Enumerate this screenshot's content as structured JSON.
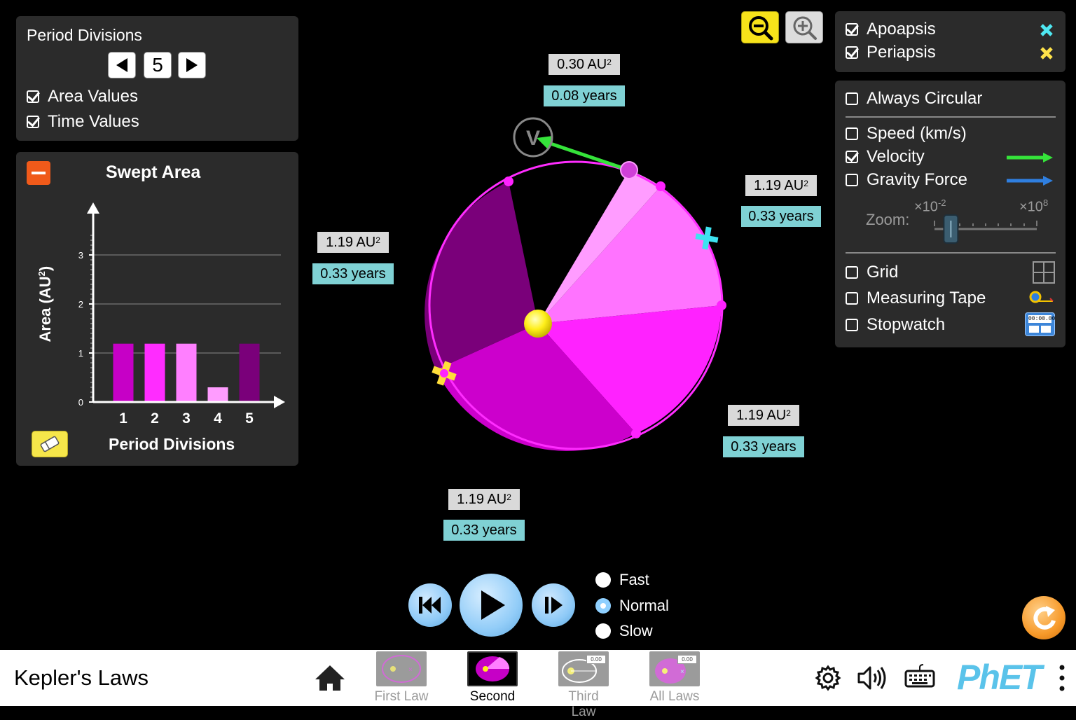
{
  "app": {
    "title": "Kepler's Laws"
  },
  "period_panel": {
    "title": "Period Divisions",
    "value": "5",
    "checkboxes": [
      {
        "label": "Area Values",
        "checked": true
      },
      {
        "label": "Time Values",
        "checked": true
      }
    ]
  },
  "swept_panel": {
    "title": "Swept Area",
    "ylabel": "Area (AU",
    "ylabel_exp": "2",
    "ylabel_close": ")",
    "xlabel": "Period Divisions"
  },
  "chart_data": {
    "type": "bar",
    "title": "Swept Area",
    "xlabel": "Period Divisions",
    "ylabel": "Area (AU²)",
    "categories": [
      "1",
      "2",
      "3",
      "4",
      "5"
    ],
    "values": [
      1.19,
      1.19,
      1.19,
      0.3,
      1.19
    ],
    "colors": [
      "#c600c6",
      "#ff2cff",
      "#ff7fff",
      "#ff9cff",
      "#7a007a"
    ],
    "y_ticks": [
      "0",
      "1",
      "2",
      "3"
    ],
    "ylim": [
      0,
      3.5
    ],
    "grid": true
  },
  "orbit_labels": [
    {
      "area": "0.30 AU",
      "time": "0.08 years"
    },
    {
      "area": "1.19 AU",
      "time": "0.33 years"
    },
    {
      "area": "1.19 AU",
      "time": "0.33 years"
    },
    {
      "area": "1.19 AU",
      "time": "0.33 years"
    },
    {
      "area": "1.19 AU",
      "time": "0.33 years"
    }
  ],
  "area_exp": "2",
  "velocity_label": "V",
  "markers_panel": {
    "items": [
      {
        "label": "Apoapsis",
        "checked": true,
        "color": "#4fe8f2"
      },
      {
        "label": "Periapsis",
        "checked": true,
        "color": "#ffe34a"
      }
    ]
  },
  "options_panel": {
    "always_circular": {
      "label": "Always Circular",
      "checked": false
    },
    "vectors": [
      {
        "label": "Speed (km/s)",
        "checked": false
      },
      {
        "label": "Velocity",
        "checked": true,
        "arrow_color": "#35e33a"
      },
      {
        "label": "Gravity Force",
        "checked": false,
        "arrow_color": "#2f7fe0"
      }
    ],
    "zoom": {
      "label": "Zoom:",
      "min_base": "×10",
      "min_exp": "-2",
      "max_base": "×10",
      "max_exp": "8",
      "value": 0.16
    },
    "tools": [
      {
        "label": "Grid",
        "checked": false,
        "icon": "grid-icon"
      },
      {
        "label": "Measuring Tape",
        "checked": false,
        "icon": "measuring-tape-icon"
      },
      {
        "label": "Stopwatch",
        "checked": false,
        "icon": "stopwatch-icon",
        "readout": "00:00.00"
      }
    ]
  },
  "speed_options": [
    {
      "label": "Fast",
      "selected": false
    },
    {
      "label": "Normal",
      "selected": true
    },
    {
      "label": "Slow",
      "selected": false
    }
  ],
  "screens": [
    {
      "label": "First Law",
      "active": false
    },
    {
      "label": "Second Law",
      "active": true
    },
    {
      "label": "Third Law",
      "active": false,
      "readout": "0.00"
    },
    {
      "label": "All Laws",
      "active": false,
      "readout": "0.00"
    }
  ],
  "brand": {
    "logo": "PhET"
  }
}
